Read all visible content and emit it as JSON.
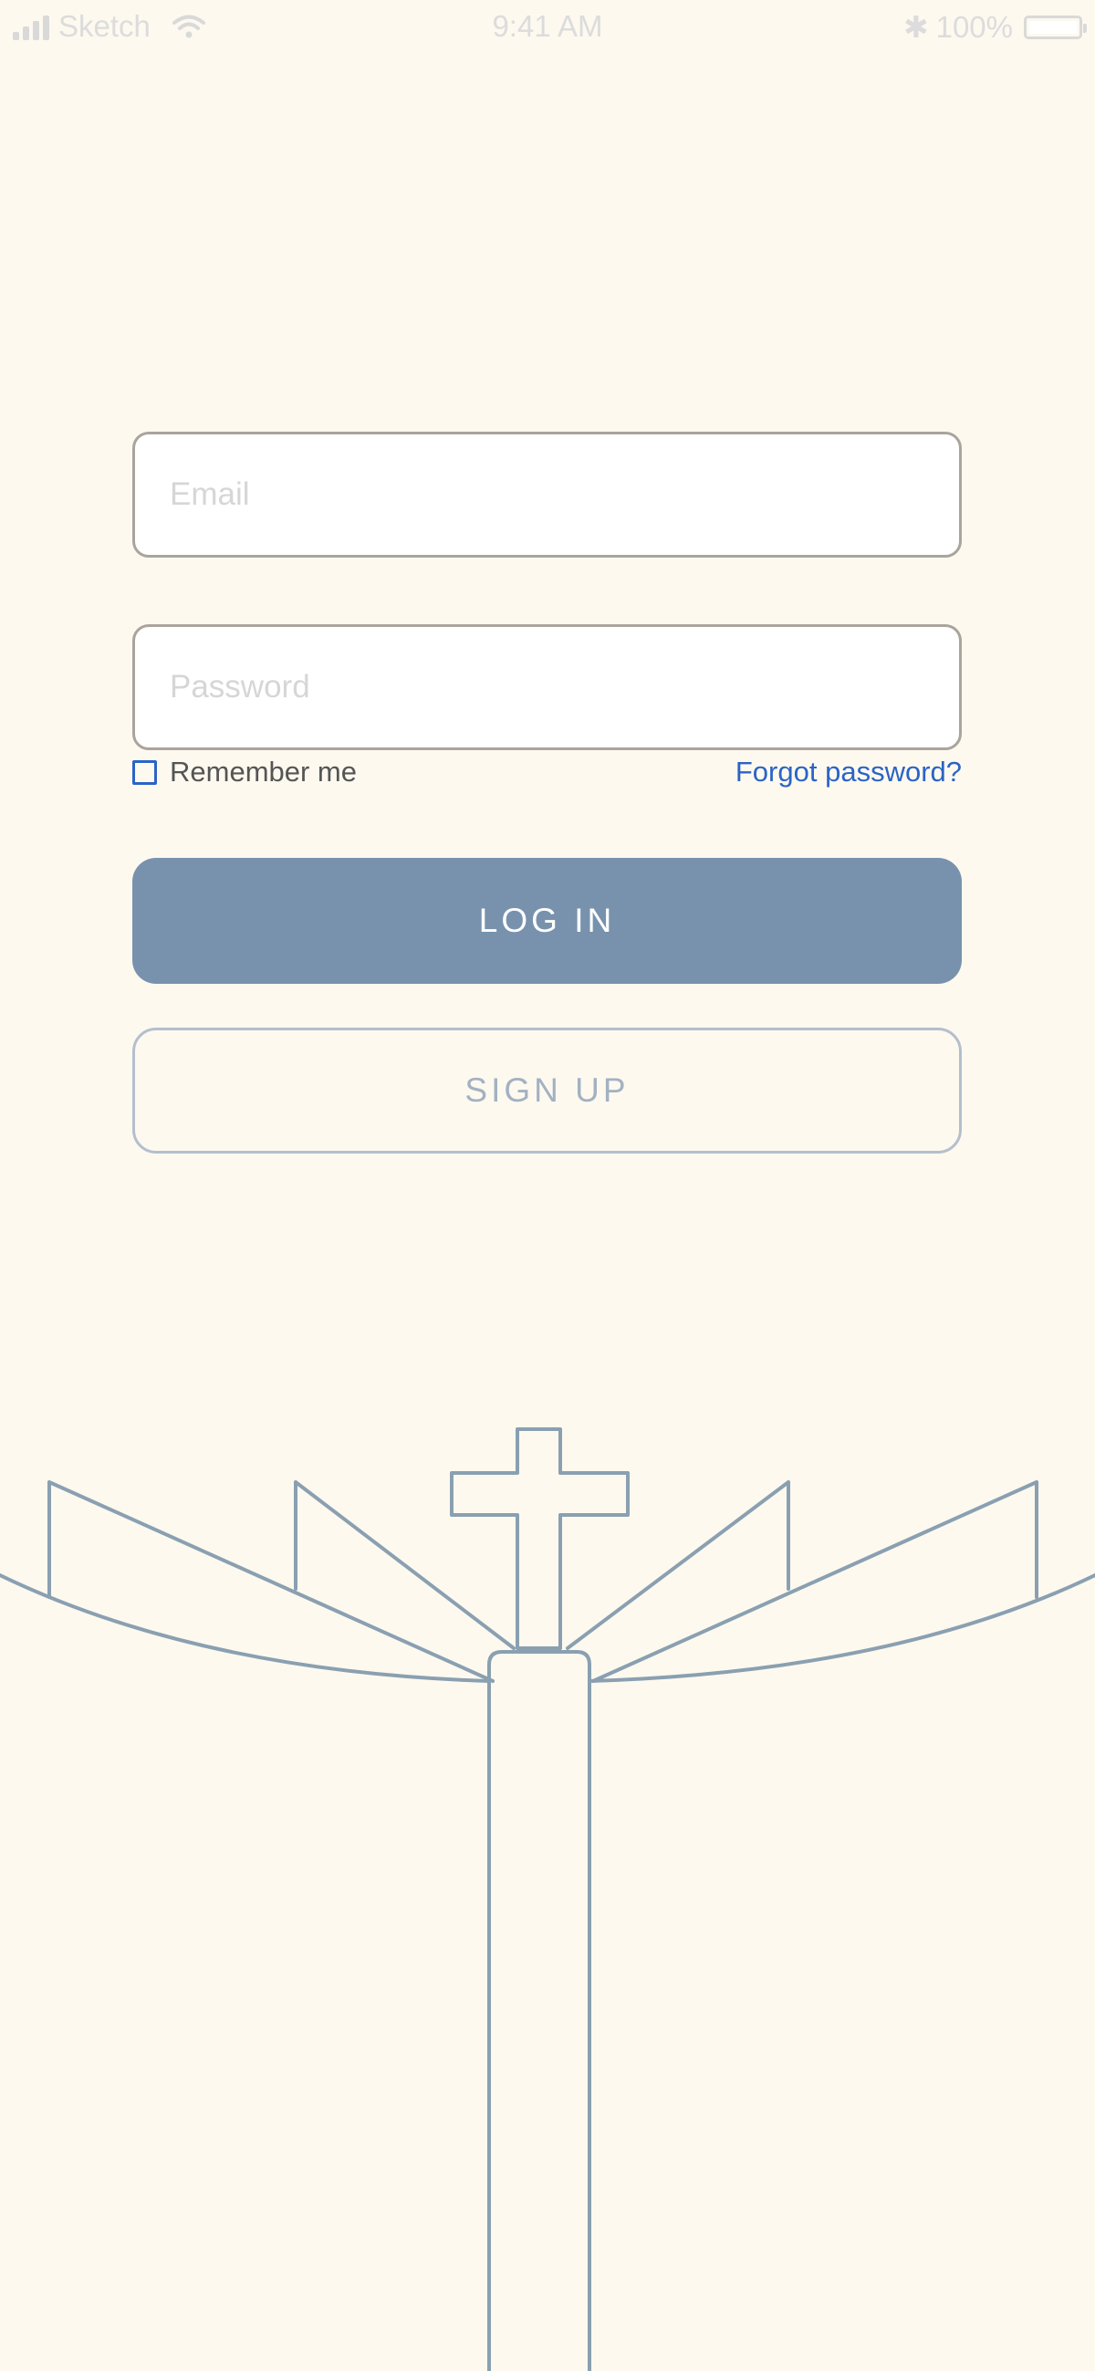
{
  "status_bar": {
    "carrier": "Sketch",
    "time": "9:41 AM",
    "bluetooth_symbol": "✱",
    "battery": "100%"
  },
  "login_form": {
    "email_placeholder": "Email",
    "password_placeholder": "Password",
    "remember_me_label": "Remember me",
    "remember_me_checked": false,
    "forgot_password_label": "Forgot password?"
  },
  "actions": {
    "login_label": "LOG IN",
    "signup_label": "SIGN UP"
  },
  "icons": {
    "signal": "signal-icon",
    "wifi": "wifi-icon",
    "bluetooth": "bluetooth-icon",
    "battery": "battery-icon",
    "illustration": "church-cross-illustration"
  },
  "colors": {
    "background": "#fdf9ef",
    "primary_button": "#7892ad",
    "link": "#2a64c6",
    "illustration_stroke": "#8aa0b1"
  }
}
